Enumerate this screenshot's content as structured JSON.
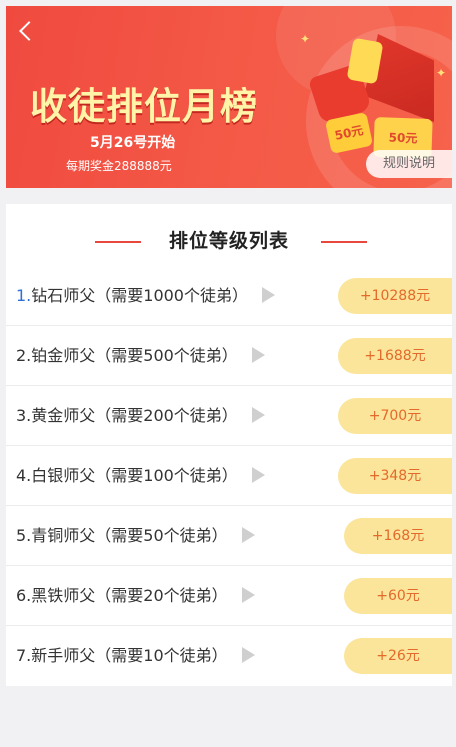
{
  "banner": {
    "title": "收徒排位月榜",
    "date_text": "5月26号开始",
    "prize_text": "每期奖金288888元",
    "rule_button": "规则说明",
    "ticket_small": "50元",
    "ticket_large": "50元",
    "colors": {
      "background": "#f04a3f",
      "title": "#fff4a8"
    }
  },
  "list": {
    "heading": "排位等级列表",
    "rows": [
      {
        "index": "1.",
        "label": "钻石师父（需要1000个徒弟）",
        "reward": "+10288元"
      },
      {
        "index": "2.",
        "label": "铂金师父（需要500个徒弟）",
        "reward": "+1688元"
      },
      {
        "index": "3.",
        "label": "黄金师父（需要200个徒弟）",
        "reward": "+700元"
      },
      {
        "index": "4.",
        "label": "白银师父（需要100个徒弟）",
        "reward": "+348元"
      },
      {
        "index": "5.",
        "label": "青铜师父（需要50个徒弟）",
        "reward": "+168元"
      },
      {
        "index": "6.",
        "label": "黑铁师父（需要20个徒弟）",
        "reward": "+60元"
      },
      {
        "index": "7.",
        "label": "新手师父（需要10个徒弟）",
        "reward": "+26元"
      }
    ],
    "colors": {
      "reward_bg": "#fbe59a",
      "reward_text": "#e36a2a",
      "accent_line": "#e8473d"
    }
  },
  "icons": {
    "back": "chevron-left-icon",
    "row_arrow": "play-triangle-icon"
  }
}
